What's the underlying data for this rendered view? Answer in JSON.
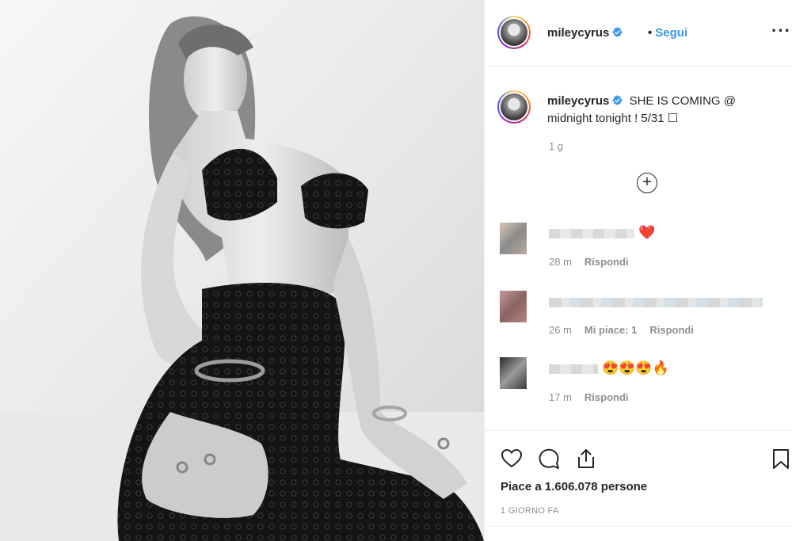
{
  "post": {
    "author": "mileycyrus",
    "follow_label": "Segui",
    "dot": "•",
    "more_label": "···",
    "verified": true
  },
  "caption": {
    "username": "mileycyrus",
    "text": "SHE IS COMING @ midnight tonight ! 5/31 ☐",
    "age": "1 g",
    "load_more": "+"
  },
  "comments": [
    {
      "emoji": "❤️",
      "age": "28 m",
      "likes": "",
      "reply": "Rispondi"
    },
    {
      "emoji": "",
      "age": "26 m",
      "likes": "Mi piace: 1",
      "reply": "Rispondi"
    },
    {
      "emoji": "😍😍😍🔥",
      "age": "17 m",
      "likes": "",
      "reply": "Rispondi"
    }
  ],
  "footer": {
    "likes_text": "Piace a 1.606.078 persone",
    "post_age": "1 GIORNO FA"
  },
  "icons": [
    "heart-icon",
    "comment-icon",
    "share-icon",
    "bookmark-icon",
    "verified-badge-icon",
    "more-options-icon"
  ],
  "colors": {
    "link": "#3897f0",
    "verified": "#3897f0",
    "muted": "#8e8e8e",
    "text": "#262626"
  }
}
